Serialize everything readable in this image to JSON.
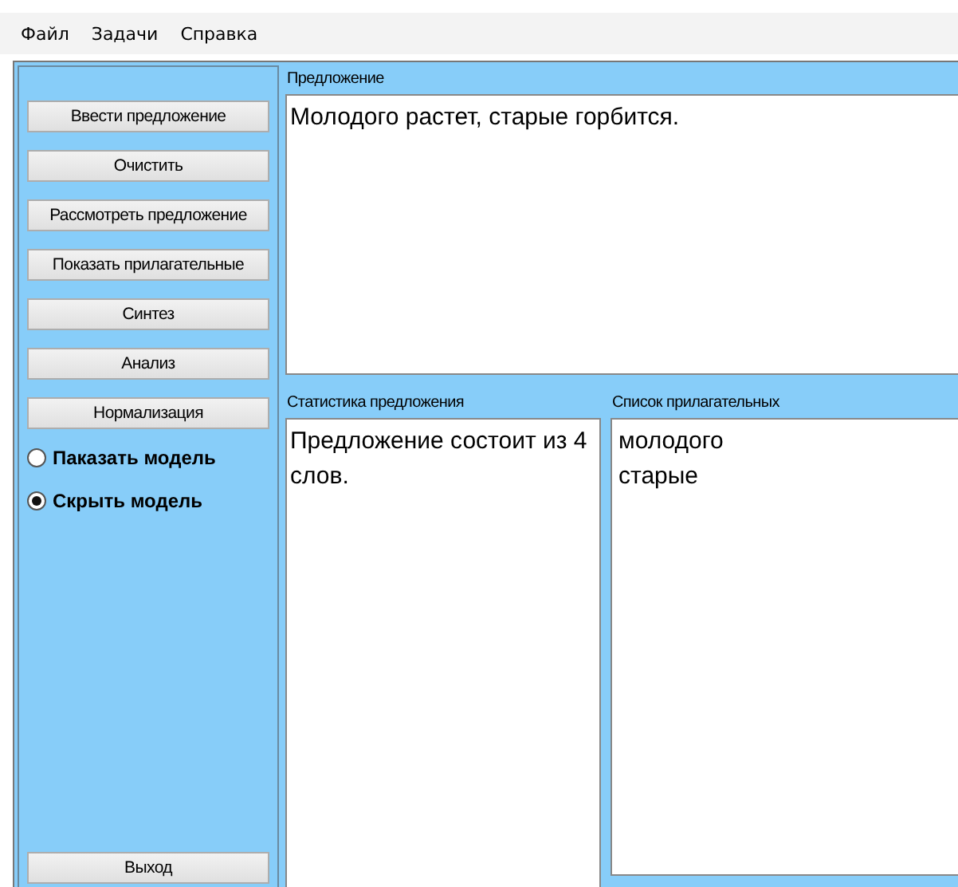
{
  "menu": [
    "Файл",
    "Задачи",
    "Справка"
  ],
  "buttons": [
    "Ввести предложение",
    "Очистить",
    "Рассмотреть предложение",
    "Показать прилагательные",
    "Синтез",
    "Анализ",
    "Нормализация"
  ],
  "radios": [
    {
      "label": "Паказать модель",
      "selected": false
    },
    {
      "label": "Скрыть модель",
      "selected": true
    }
  ],
  "exit_button": "Выход",
  "sentence": {
    "label": "Предложение",
    "value": "Молодого растет, старые горбится."
  },
  "statistics": {
    "label": "Статистика предложения",
    "value": "Предложение состоит из 4 слов."
  },
  "adjectives": {
    "label": "Список прилагательных",
    "items": [
      "молодого",
      "старые"
    ]
  }
}
